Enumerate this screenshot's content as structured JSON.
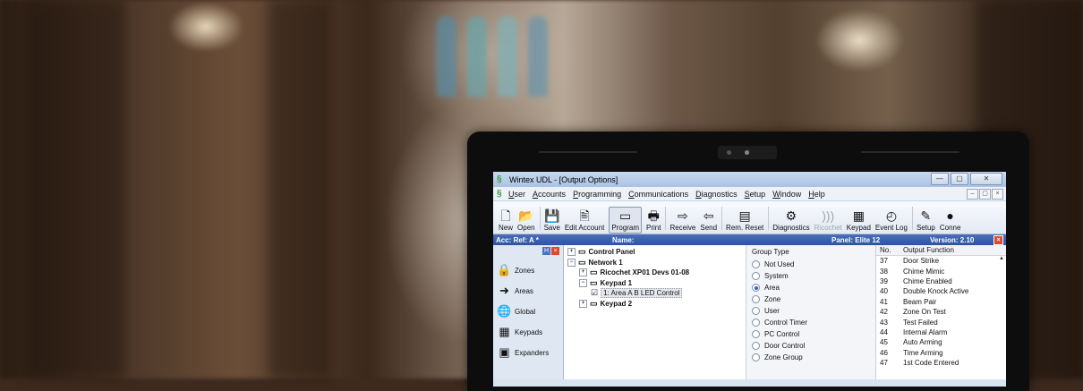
{
  "window": {
    "title": "Wintex UDL - [Output Options]"
  },
  "menu": [
    {
      "label": "User",
      "u": "U",
      "rest": "ser"
    },
    {
      "label": "Accounts",
      "u": "A",
      "rest": "ccounts"
    },
    {
      "label": "Programming",
      "u": "P",
      "rest": "rogramming"
    },
    {
      "label": "Communications",
      "u": "C",
      "rest": "ommunications"
    },
    {
      "label": "Diagnostics",
      "u": "D",
      "rest": "iagnostics"
    },
    {
      "label": "Setup",
      "u": "S",
      "rest": "etup"
    },
    {
      "label": "Window",
      "u": "W",
      "rest": "indow"
    },
    {
      "label": "Help",
      "u": "H",
      "rest": "elp"
    }
  ],
  "toolbar": [
    {
      "label": "New",
      "icon": "new-icon",
      "glyph": "🗋"
    },
    {
      "label": "Open",
      "icon": "open-icon",
      "glyph": "📂"
    },
    {
      "label": "Save",
      "icon": "save-icon",
      "glyph": "💾"
    },
    {
      "label": "Edit Account",
      "icon": "edit-account-icon",
      "glyph": "🖹"
    },
    {
      "label": "Program",
      "icon": "program-icon",
      "glyph": "▭",
      "active": true
    },
    {
      "label": "Print",
      "icon": "print-icon",
      "glyph": "🖶"
    },
    {
      "label": "Receive",
      "icon": "receive-icon",
      "glyph": "⇨"
    },
    {
      "label": "Send",
      "icon": "send-icon",
      "glyph": "⇦"
    },
    {
      "label": "Rem. Reset",
      "icon": "rem-reset-icon",
      "glyph": "▤"
    },
    {
      "label": "Diagnostics",
      "icon": "diagnostics-icon",
      "glyph": "⚙"
    },
    {
      "label": "Ricochet",
      "icon": "ricochet-icon",
      "glyph": ")))",
      "disabled": true
    },
    {
      "label": "Keypad",
      "icon": "keypad-icon",
      "glyph": "▦"
    },
    {
      "label": "Event Log",
      "icon": "event-log-icon",
      "glyph": "◴"
    },
    {
      "label": "Setup",
      "icon": "setup-icon",
      "glyph": "✎"
    },
    {
      "label": "Conne",
      "icon": "connect-icon",
      "glyph": "●"
    }
  ],
  "infobar": {
    "acc_ref": "Acc: Ref: A *",
    "name": "Name:",
    "panel": "Panel: Elite 12",
    "version": "Version: 2.10"
  },
  "nav": [
    {
      "label": "Zones",
      "icon": "zones-icon",
      "glyph": "🔒"
    },
    {
      "label": "Areas",
      "icon": "areas-icon",
      "glyph": "➜"
    },
    {
      "label": "Global",
      "icon": "global-icon",
      "glyph": "🌐"
    },
    {
      "label": "Keypads",
      "icon": "keypads-icon",
      "glyph": "▦"
    },
    {
      "label": "Expanders",
      "icon": "expanders-icon",
      "glyph": "▣"
    }
  ],
  "tree": [
    {
      "label": "Control Panel",
      "indent": 0,
      "bold": true,
      "tog": "+"
    },
    {
      "label": "Network 1",
      "indent": 0,
      "bold": true,
      "tog": "−"
    },
    {
      "label": "Ricochet XP01 Devs 01-08",
      "indent": 1,
      "bold": true,
      "tog": "+"
    },
    {
      "label": "Keypad 1",
      "indent": 1,
      "bold": true,
      "tog": "−"
    },
    {
      "label": "1: Area A B LED Control",
      "indent": 2,
      "bold": false,
      "tog": "",
      "sel": true
    },
    {
      "label": "Keypad 2",
      "indent": 1,
      "bold": true,
      "tog": "+"
    }
  ],
  "group_type": {
    "title": "Group Type",
    "options": [
      "Not Used",
      "System",
      "Area",
      "Zone",
      "User",
      "Control Timer",
      "PC Control",
      "Door Control",
      "Zone Group"
    ],
    "selected": "Area"
  },
  "outputs": {
    "headers": [
      "No.",
      "Output Function"
    ],
    "rows": [
      [
        "37",
        "Door Strike"
      ],
      [
        "38",
        "Chime Mimic"
      ],
      [
        "39",
        "Chime Enabled"
      ],
      [
        "40",
        "Double Knock Active"
      ],
      [
        "41",
        "Beam Pair"
      ],
      [
        "42",
        "Zone On Test"
      ],
      [
        "43",
        "Test Failed"
      ],
      [
        "44",
        "Internal Alarm"
      ],
      [
        "45",
        "Auto Arming"
      ],
      [
        "46",
        "Time Arming"
      ],
      [
        "47",
        "1st Code Entered"
      ]
    ]
  }
}
